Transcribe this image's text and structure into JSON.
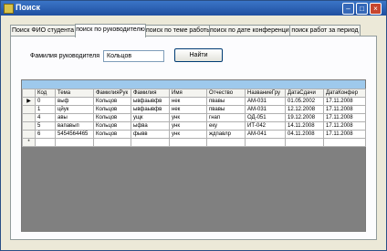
{
  "window": {
    "title": "Поиск"
  },
  "tabs": [
    {
      "label": "Поиск ФИО студента",
      "active": false
    },
    {
      "label": "поиск по руководителю",
      "active": true
    },
    {
      "label": "поиск по теме работы",
      "active": false
    },
    {
      "label": "поиск по дате конференции",
      "active": false
    },
    {
      "label": "поиск работ за период",
      "active": false
    }
  ],
  "search": {
    "label": "Фамилия руководителя",
    "value": "Кольцов",
    "button_label": "Найти"
  },
  "grid": {
    "columns": [
      "Код",
      "Тема",
      "ФамилияРук",
      "Фамилия",
      "Имя",
      "Отчество",
      "НазваниеГру",
      "ДатаСдачи",
      "ДатаКонфер"
    ],
    "rows": [
      {
        "selected": true,
        "cells": [
          "0",
          "выф",
          "Кольцов",
          "ывфаывфв",
          "нек",
          "пвавы",
          "АМ-031",
          "01.05.2002",
          "17.11.2008"
        ]
      },
      {
        "selected": false,
        "cells": [
          "1",
          "цйук",
          "Кольцов",
          "ывфаывфв",
          "нек",
          "пвавы",
          "АМ-031",
          "12.12.2008",
          "17.11.2008"
        ]
      },
      {
        "selected": false,
        "cells": [
          "4",
          "авы",
          "Кольцов",
          "ущк",
          "унк",
          "гнап",
          "ОД-051",
          "19.12.2008",
          "17.11.2008"
        ]
      },
      {
        "selected": false,
        "cells": [
          "5",
          "вапавып",
          "Кольцов",
          "ыфва",
          "унк",
          "еку",
          "ИТ-042",
          "14.11.2008",
          "17.11.2008"
        ]
      },
      {
        "selected": false,
        "cells": [
          "6",
          "5454564465",
          "Кольцов",
          "фывв",
          "унк",
          "ждпавлр",
          "АМ-041",
          "04.11.2008",
          "17.11.2008"
        ]
      }
    ],
    "new_row_marker": "*",
    "current_row_marker": "▶"
  },
  "colors": {
    "titlebar": "#1f4fa0",
    "grid_background": "#808080",
    "grid_header_strip": "#9ec9ec",
    "window_face": "#ece9d8"
  }
}
